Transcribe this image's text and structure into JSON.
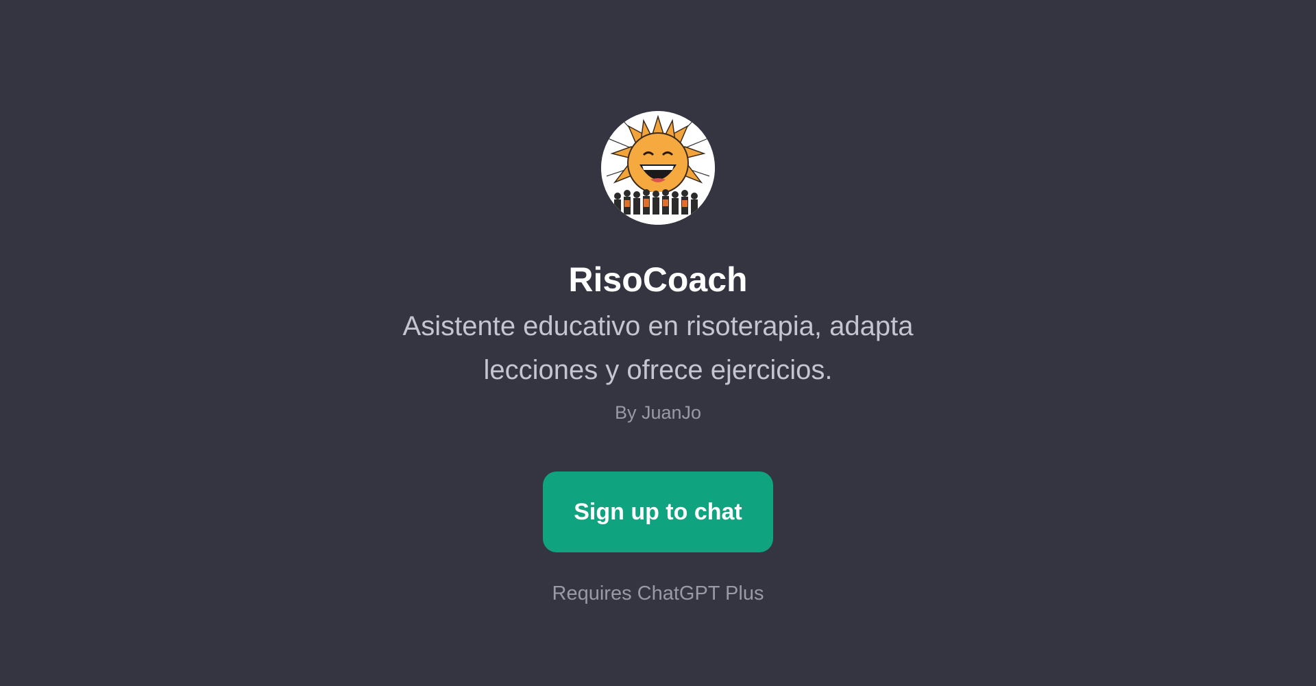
{
  "gpt": {
    "avatar_icon": "laughing-sun-crowd-icon",
    "name": "RisoCoach",
    "description": "Asistente educativo en risoterapia, adapta lecciones y ofrece ejercicios.",
    "author": "By JuanJo"
  },
  "cta": {
    "label": "Sign up to chat"
  },
  "requirement": "Requires ChatGPT Plus",
  "colors": {
    "background": "#343541",
    "accent": "#10a37f",
    "title": "#ffffff",
    "description": "#c5c5d2",
    "muted": "#9a9aa6"
  }
}
